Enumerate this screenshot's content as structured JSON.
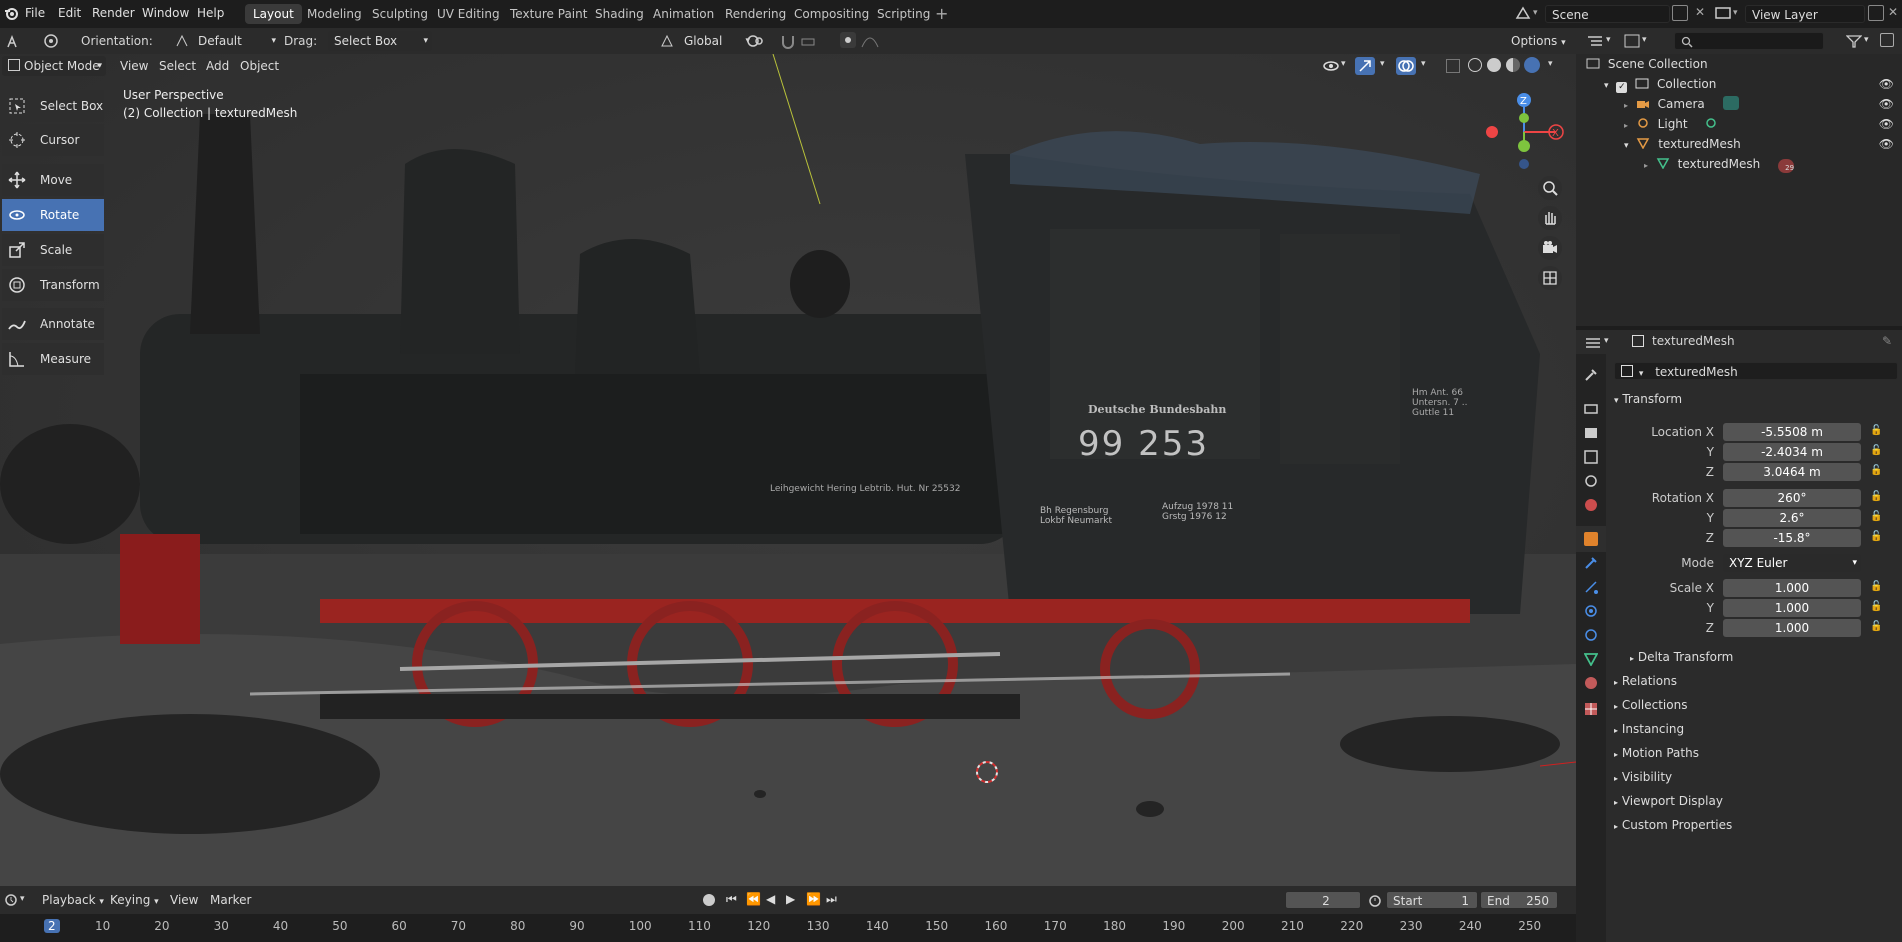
{
  "menu": {
    "file": "File",
    "edit": "Edit",
    "render": "Render",
    "window": "Window",
    "help": "Help"
  },
  "workspaces": [
    "Layout",
    "Modeling",
    "Sculpting",
    "UV Editing",
    "Texture Paint",
    "Shading",
    "Animation",
    "Rendering",
    "Compositing",
    "Scripting"
  ],
  "active_workspace": "Layout",
  "scene": "Scene",
  "view_layer": "View Layer",
  "header": {
    "orientation_label": "Orientation:",
    "orientation_value": "Default",
    "drag_label": "Drag:",
    "drag_value": "Select Box",
    "transform_orientation": "Global",
    "options": "Options"
  },
  "viewport_header": {
    "mode": "Object Mode",
    "view": "View",
    "select": "Select",
    "add": "Add",
    "object": "Object"
  },
  "viewport_overlay": {
    "perspective": "User Perspective",
    "collection": "(2) Collection | texturedMesh"
  },
  "toolbar": [
    {
      "label": "Select Box",
      "icon": "select-box-icon"
    },
    {
      "label": "Cursor",
      "icon": "cursor-icon"
    },
    {
      "label": "Move",
      "icon": "move-icon"
    },
    {
      "label": "Rotate",
      "icon": "rotate-icon",
      "active": true
    },
    {
      "label": "Scale",
      "icon": "scale-icon"
    },
    {
      "label": "Transform",
      "icon": "transform-icon"
    },
    {
      "label": "Annotate",
      "icon": "annotate-icon"
    },
    {
      "label": "Measure",
      "icon": "measure-icon"
    }
  ],
  "locomotive_text": {
    "company": "Deutsche Bundesbahn",
    "number": "99 253",
    "left_plate": "Leihgewicht Hering  Lebtrib. Hut. Nr 25532",
    "depot": "Bh Regensburg\nLokbf Neumarkt",
    "dates": "Aufzug 1978 11\nGrstg 1976 12",
    "right_plate": "Hm Ant. 66\nUntersn. 7 ..\nGuttle 11"
  },
  "outliner": {
    "root": "Scene Collection",
    "collection": "Collection",
    "items": [
      "Camera",
      "Light",
      "texturedMesh"
    ],
    "mesh_child": "texturedMesh",
    "mesh_child_badge": "29"
  },
  "properties": {
    "object_name": "texturedMesh",
    "object_field": "texturedMesh",
    "transform_section": "Transform",
    "location_label": "Location X",
    "rotation_label": "Rotation X",
    "scale_label": "Scale X",
    "y_label": "Y",
    "z_label": "Z",
    "location": [
      "-5.5508 m",
      "-2.4034 m",
      "3.0464 m"
    ],
    "rotation": [
      "260°",
      "2.6°",
      "-15.8°"
    ],
    "mode_label": "Mode",
    "mode_value": "XYZ Euler",
    "scale": [
      "1.000",
      "1.000",
      "1.000"
    ],
    "delta": "Delta Transform",
    "sections": [
      "Relations",
      "Collections",
      "Instancing",
      "Motion Paths",
      "Visibility",
      "Viewport Display",
      "Custom Properties"
    ]
  },
  "timeline": {
    "playback": "Playback",
    "keying": "Keying",
    "view": "View",
    "marker": "Marker",
    "current_frame": "2",
    "start_label": "Start",
    "start": "1",
    "end_label": "End",
    "end": "250",
    "ticks": [
      "2",
      "10",
      "20",
      "30",
      "40",
      "50",
      "60",
      "70",
      "80",
      "90",
      "100",
      "110",
      "120",
      "130",
      "140",
      "150",
      "160",
      "170",
      "180",
      "190",
      "200",
      "210",
      "220",
      "230",
      "240",
      "250"
    ]
  },
  "colors": {
    "accent": "#4772b3",
    "x_axis": "#ee4545",
    "y_axis": "#7ec43e",
    "z_axis": "#4a8ee8"
  }
}
